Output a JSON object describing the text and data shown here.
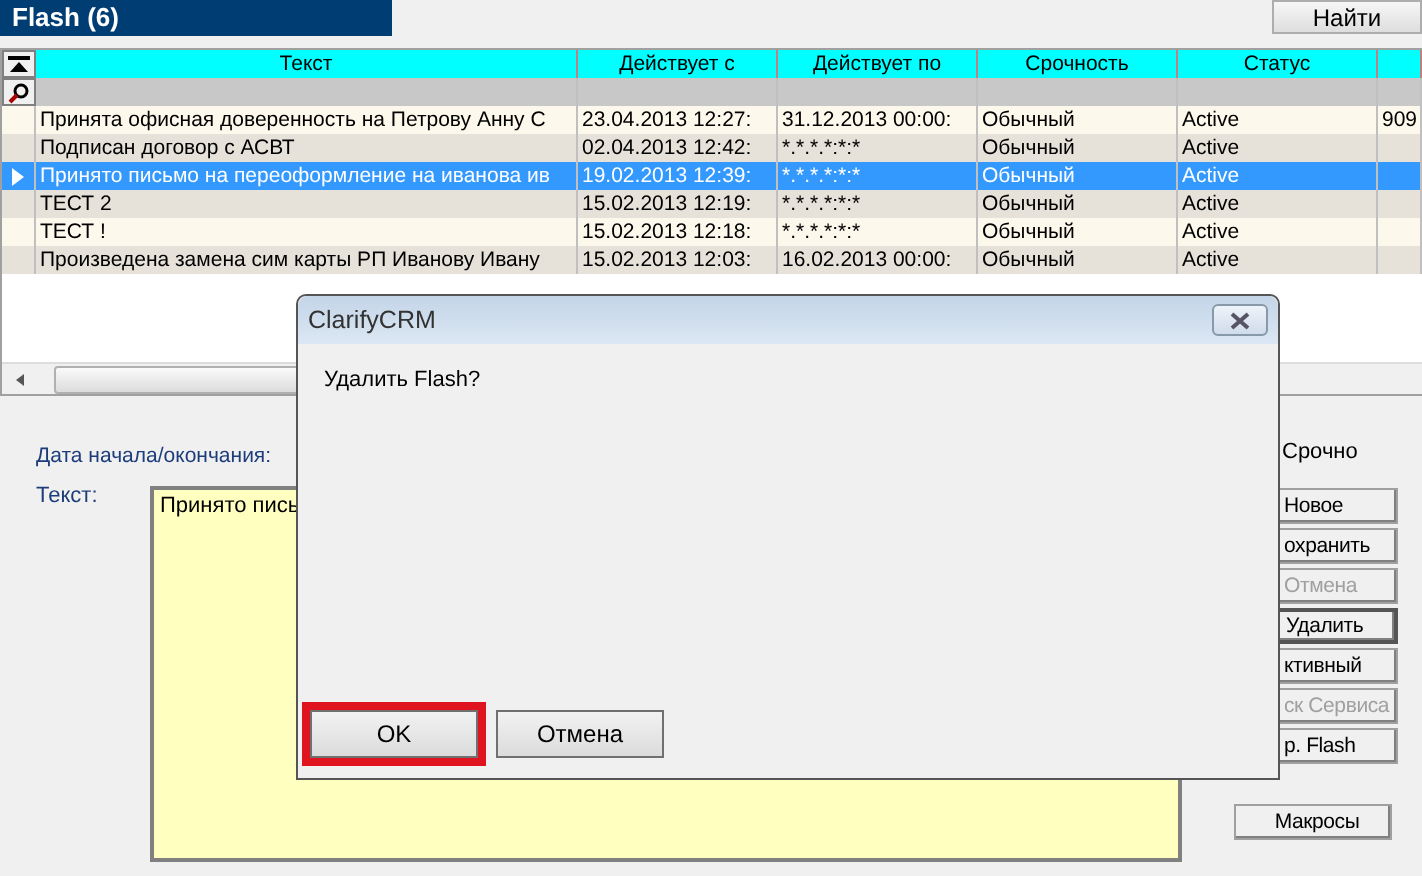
{
  "header": {
    "title": "Flash (6)",
    "find_button": "Найти"
  },
  "table": {
    "columns": [
      "Текст",
      "Действует с",
      "Действует по",
      "Срочность",
      "Статус"
    ],
    "rows": [
      {
        "cells": [
          "Принята офисная доверенность на Петрову Анну С",
          "23.04.2013 12:27:",
          "31.12.2013 00:00:",
          "Обычный",
          "Active"
        ],
        "column_7": "909",
        "selected": false
      },
      {
        "cells": [
          "Подписан договор с АСВТ",
          "02.04.2013 12:42:",
          "*.*.*.*:*:*",
          "Обычный",
          "Active"
        ],
        "selected": false
      },
      {
        "cells": [
          "Принято письмо на переоформление на иванова ив",
          "19.02.2013 12:39:",
          "*.*.*.*:*:*",
          "Обычный",
          "Active"
        ],
        "selected": true
      },
      {
        "cells": [
          "ТЕСТ 2",
          "15.02.2013 12:19:",
          "*.*.*.*:*:*",
          "Обычный",
          "Active"
        ],
        "selected": false
      },
      {
        "cells": [
          "ТЕСТ !",
          "15.02.2013 12:18:",
          "*.*.*.*:*:*",
          "Обычный",
          "Active"
        ],
        "selected": false
      },
      {
        "cells": [
          "Произведена замена сим карты РП Иванову Ивану",
          "15.02.2013 12:03:",
          "16.02.2013 00:00:",
          "Обычный",
          "Active"
        ],
        "selected": false
      }
    ]
  },
  "form": {
    "date_label": "Дата начала/окончания:",
    "text_label": "Текст:",
    "text_value": "Принято пись",
    "urgent_label": "Срочно",
    "buttons": [
      {
        "label": "Новое",
        "disabled": false
      },
      {
        "label": "охранить",
        "disabled": false
      },
      {
        "label": "Отмена",
        "disabled": true
      },
      {
        "label": "Удалить",
        "disabled": false
      },
      {
        "label": "ктивный",
        "disabled": false
      },
      {
        "label": "ск Сервиса",
        "disabled": true
      },
      {
        "label": "р. Flash",
        "disabled": false
      }
    ],
    "macros_button": "Макросы"
  },
  "dialog": {
    "title": "ClarifyCRM",
    "message": "Удалить Flash?",
    "buttons": [
      {
        "label": "OK",
        "highlighted": true
      },
      {
        "label": "Отмена",
        "highlighted": false
      }
    ]
  }
}
